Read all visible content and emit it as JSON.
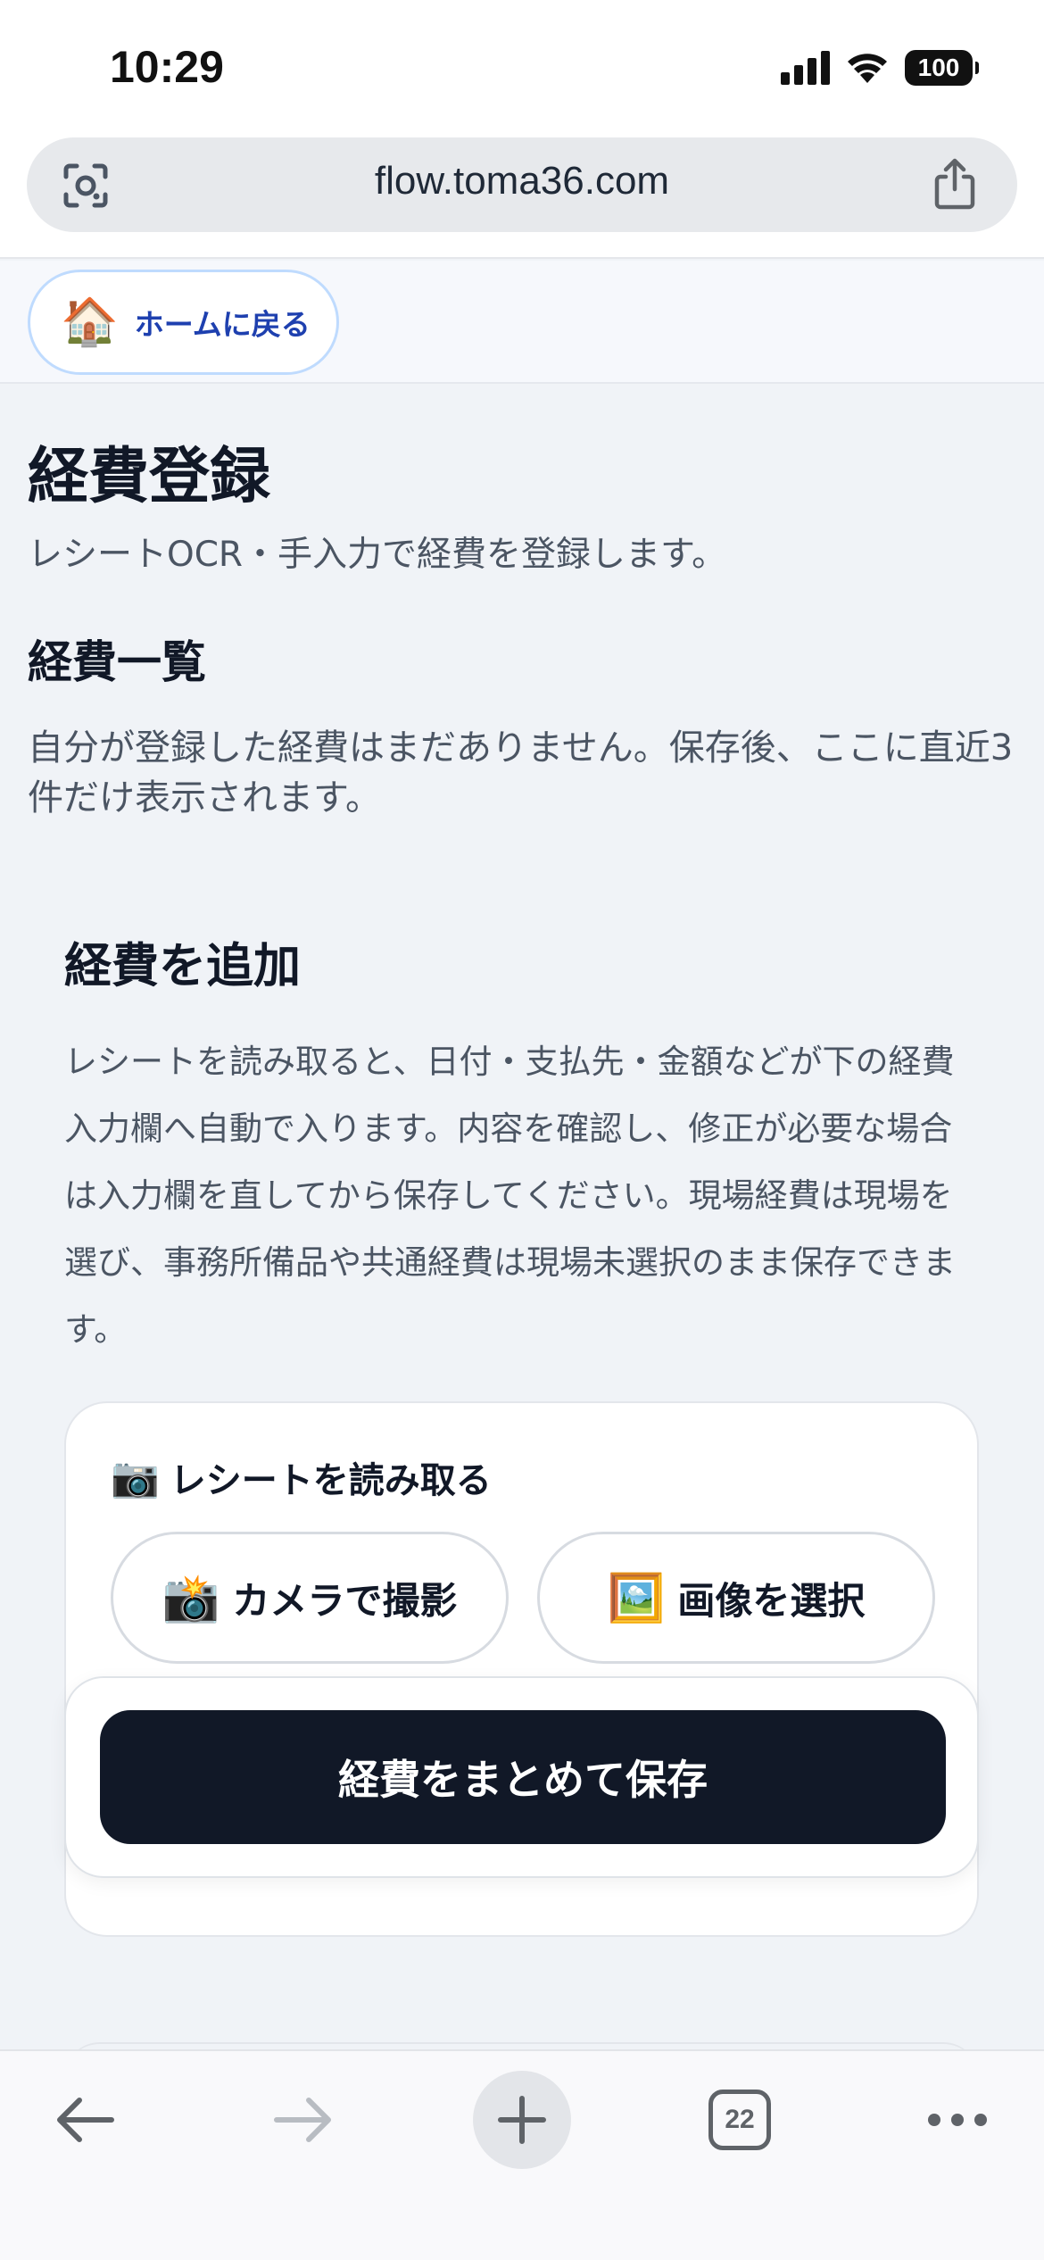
{
  "status_bar": {
    "time": "10:29",
    "battery": "100"
  },
  "browser": {
    "url": "flow.toma36.com",
    "tab_count": "22"
  },
  "nav": {
    "home_label": "ホームに戻る",
    "home_emoji": "🏠"
  },
  "page": {
    "title": "経費登録",
    "subtitle": "レシートOCR・手入力で経費を登録します。",
    "list_title": "経費一覧",
    "empty_text": "自分が登録した経費はまだありません。保存後、ここに直近3件だけ表示されます。"
  },
  "add_section": {
    "title": "経費を追加",
    "description": "レシートを読み取ると、日付・支払先・金額などが下の経費入力欄へ自動で入ります。内容を確認し、修正が必要な場合は入力欄を直してから保存してください。現場経費は現場を選び、事務所備品や共通経費は現場未選択のまま保存できます。"
  },
  "receipt": {
    "emoji": "📷",
    "title": "レシートを読み取る",
    "camera_emoji": "📸",
    "camera_label": "カメラで撮影",
    "image_emoji": "🖼️",
    "image_label": "画像を選択"
  },
  "save": {
    "label": "経費をまとめて保存"
  }
}
